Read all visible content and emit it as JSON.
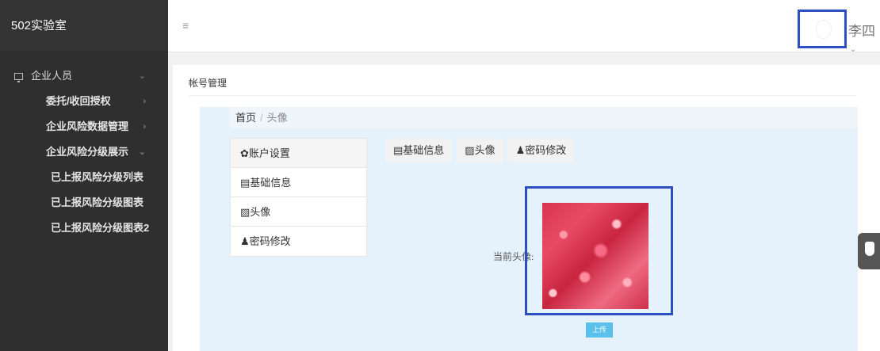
{
  "sidebar": {
    "logo": "502实验室",
    "items": [
      {
        "label": "企业人员",
        "arrow": "⌄"
      },
      {
        "label": "委托/收回授权",
        "arrow": "›"
      },
      {
        "label": "企业风险数据管理",
        "arrow": "›"
      },
      {
        "label": "企业风险分级展示",
        "arrow": "⌄"
      },
      {
        "label": "已上报风险分级列表"
      },
      {
        "label": "已上报风险分级图表"
      },
      {
        "label": "已上报风险分级图表2"
      }
    ]
  },
  "header": {
    "menu_icon": "≡",
    "username": "李四",
    "user_caret": "⌄"
  },
  "main": {
    "title": "帐号管理",
    "breadcrumb": {
      "home": "首页",
      "separator": "/",
      "current": "头像"
    },
    "sidemenu": {
      "head": "✿账户设置",
      "items": [
        "▤基础信息",
        "▨头像",
        "♟密码修改"
      ]
    },
    "tabs": [
      "▤基础信息",
      "▨头像",
      "♟密码修改"
    ],
    "current_avatar_label": "当前头像:",
    "upload_label": "上传"
  },
  "colors": {
    "sidebar_bg": "#2f2f2f",
    "highlight": "#2e4fbf",
    "panel_bg": "#e6f2fb",
    "upload_button": "#5bc0eb"
  }
}
